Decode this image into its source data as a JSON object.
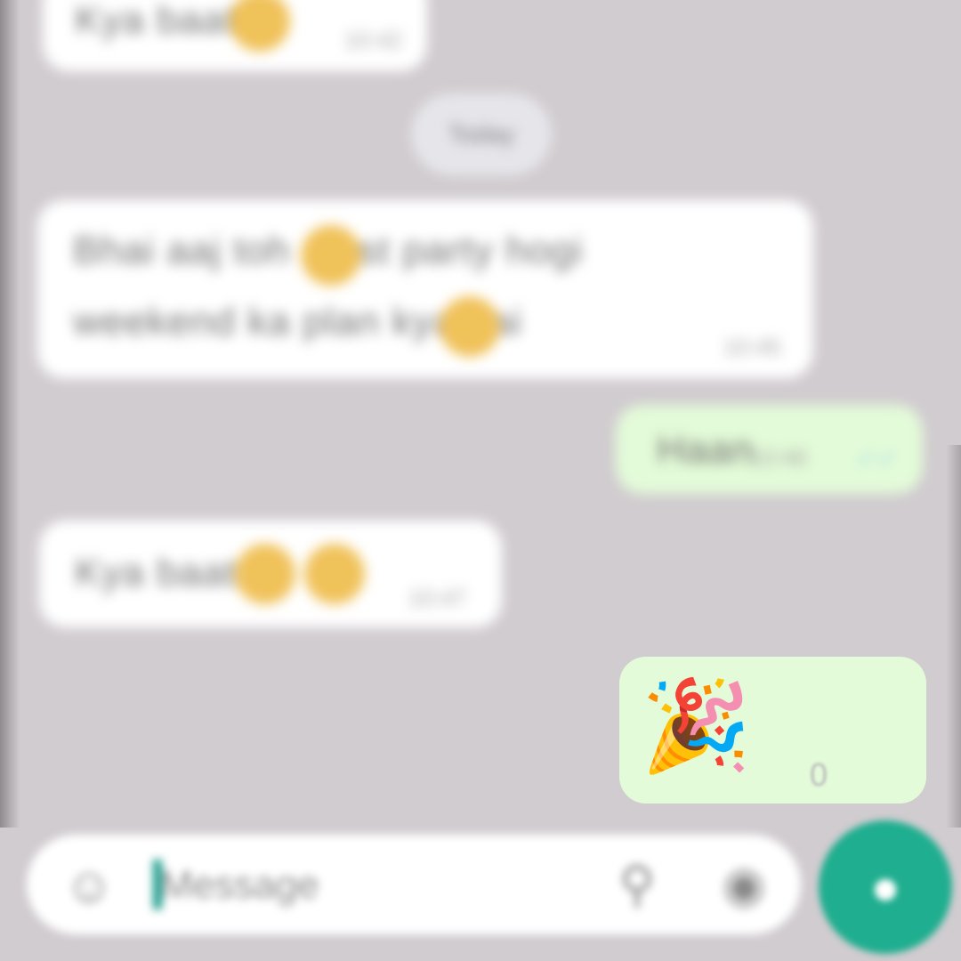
{
  "messages": [
    {
      "direction": "incoming",
      "text": "Kya baat",
      "time": "10:42"
    },
    {
      "direction": "incoming",
      "text_line1": "Bhai aaj toh mast party hogi",
      "text_line2": "weekend ka plan kya hai",
      "time": "10:45"
    },
    {
      "direction": "outgoing",
      "text": "Haan",
      "time": "10:46"
    },
    {
      "direction": "incoming",
      "text": "Kya baat",
      "time": "10:47"
    },
    {
      "direction": "outgoing",
      "sticker": "🎉",
      "time": "0"
    }
  ],
  "date_separator": "Today",
  "composer": {
    "placeholder": "Message",
    "emoji_icon": "emoji-icon",
    "attach_icon": "paperclip-icon",
    "camera_icon": "camera-icon",
    "send_icon": "microphone-icon"
  },
  "colors": {
    "wallpaper": "#d1ccd0",
    "incoming_bubble": "#ffffff",
    "outgoing_bubble": "#e3fbd8",
    "accent": "#1fae8f"
  }
}
